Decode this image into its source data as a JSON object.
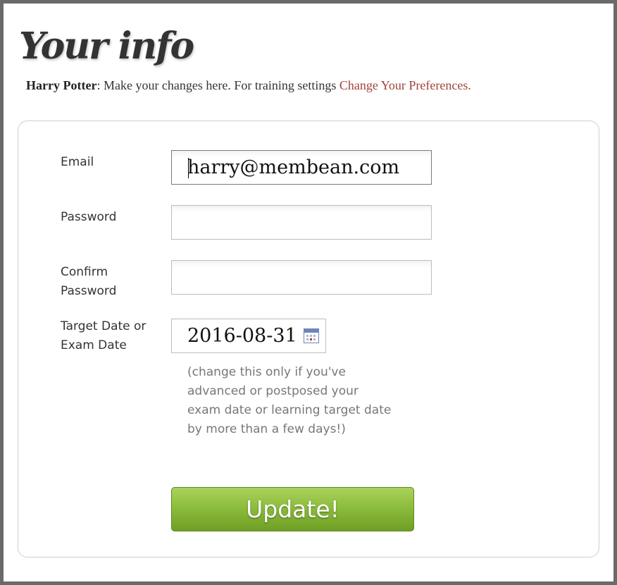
{
  "page": {
    "title": "Your info"
  },
  "intro": {
    "user_name": "Harry Potter",
    "text": ": Make your changes here. For training settings ",
    "link_label": "Change Your Preferences."
  },
  "form": {
    "email": {
      "label": "Email",
      "value": "harry@membean.com"
    },
    "password": {
      "label": "Password",
      "value": ""
    },
    "confirm_password": {
      "label": "Confirm Password",
      "value": ""
    },
    "target_date": {
      "label": "Target Date or Exam Date",
      "value": "2016-08-31",
      "icon": "calendar-icon"
    },
    "hint": "(change this only if you've advanced or postposed your exam date or learning target date by more than a few days!)",
    "submit_label": "Update!"
  },
  "colors": {
    "link": "#a0433a",
    "button_green": "#8dbd3d",
    "panel_border": "#cfcfcf"
  }
}
